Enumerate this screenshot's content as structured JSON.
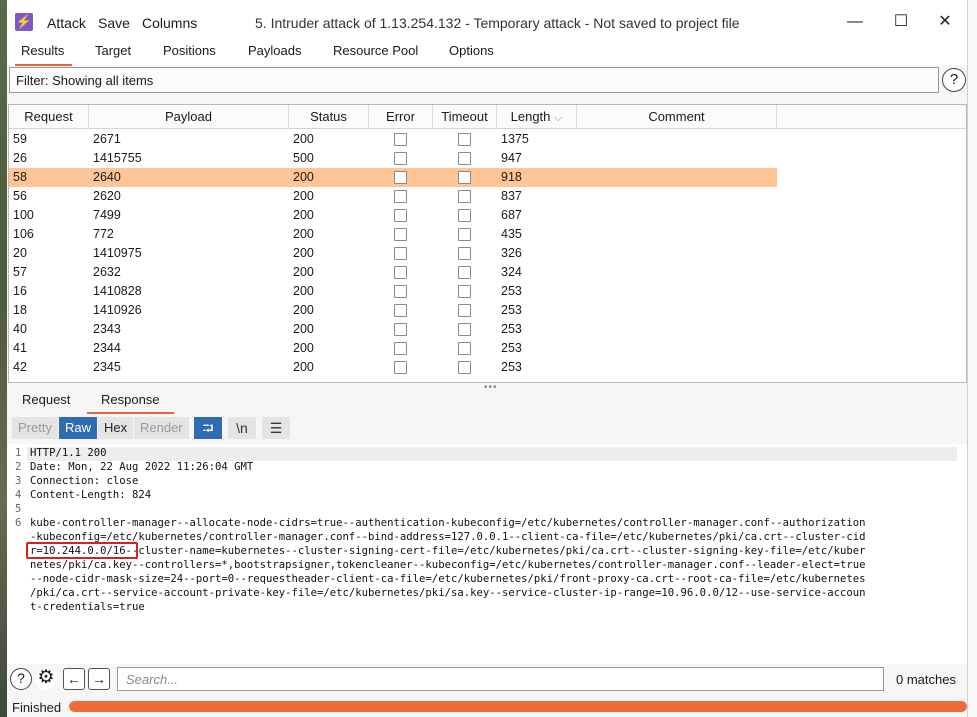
{
  "titlebar": {
    "menus": [
      "Attack",
      "Save",
      "Columns"
    ],
    "title": "5. Intruder attack of 1.13.254.132 - Temporary attack - Not saved to project file",
    "minimize": "—",
    "maximize": "☐",
    "close": "✕"
  },
  "main_tabs": [
    "Results",
    "Target",
    "Positions",
    "Payloads",
    "Resource Pool",
    "Options"
  ],
  "filter": {
    "text": "Filter: Showing all items",
    "help": "?"
  },
  "table": {
    "columns": [
      "Request",
      "Payload",
      "Status",
      "Error",
      "Timeout",
      "Length",
      "Comment"
    ],
    "sort_indicator": "⌵",
    "rows": [
      {
        "request": "59",
        "payload": "2671",
        "status": "200",
        "length": "1375",
        "selected": false
      },
      {
        "request": "26",
        "payload": "1415755",
        "status": "500",
        "length": "947",
        "selected": false
      },
      {
        "request": "58",
        "payload": "2640",
        "status": "200",
        "length": "918",
        "selected": true
      },
      {
        "request": "56",
        "payload": "2620",
        "status": "200",
        "length": "837",
        "selected": false
      },
      {
        "request": "100",
        "payload": "7499",
        "status": "200",
        "length": "687",
        "selected": false
      },
      {
        "request": "106",
        "payload": "772",
        "status": "200",
        "length": "435",
        "selected": false
      },
      {
        "request": "20",
        "payload": "1410975",
        "status": "200",
        "length": "326",
        "selected": false
      },
      {
        "request": "57",
        "payload": "2632",
        "status": "200",
        "length": "324",
        "selected": false
      },
      {
        "request": "16",
        "payload": "1410828",
        "status": "200",
        "length": "253",
        "selected": false
      },
      {
        "request": "18",
        "payload": "1410926",
        "status": "200",
        "length": "253",
        "selected": false
      },
      {
        "request": "40",
        "payload": "2343",
        "status": "200",
        "length": "253",
        "selected": false
      },
      {
        "request": "41",
        "payload": "2344",
        "status": "200",
        "length": "253",
        "selected": false
      },
      {
        "request": "42",
        "payload": "2345",
        "status": "200",
        "length": "253",
        "selected": false
      }
    ]
  },
  "sub_tabs": [
    "Request",
    "Response"
  ],
  "view_buttons": [
    "Pretty",
    "Raw",
    "Hex",
    "Render"
  ],
  "icon_buttons": [
    {
      "name": "wrap-lines-icon",
      "glyph": "⮒"
    },
    {
      "name": "newline-icon",
      "glyph": "\\n"
    },
    {
      "name": "menu-icon",
      "glyph": "☰"
    }
  ],
  "response": {
    "line_numbers": [
      "1",
      "2",
      "3",
      "4",
      "5",
      "6"
    ],
    "lines": [
      "HTTP/1.1 200",
      "Date: Mon, 22 Aug 2022 11:26:04 GMT",
      "Connection: close",
      "Content-Length: 824",
      "",
      "kube-controller-manager--allocate-node-cidrs=true--authentication-kubeconfig=/etc/kubernetes/controller-manager.conf--authorization",
      "-kubeconfig=/etc/kubernetes/controller-manager.conf--bind-address=127.0.0.1--client-ca-file=/etc/kubernetes/pki/ca.crt--cluster-cid",
      "r=10.244.0.0/16--cluster-name=kubernetes--cluster-signing-cert-file=/etc/kubernetes/pki/ca.crt--cluster-signing-key-file=/etc/kuber",
      "netes/pki/ca.key--controllers=*,bootstrapsigner,tokencleaner--kubeconfig=/etc/kubernetes/controller-manager.conf--leader-elect=true",
      "--node-cidr-mask-size=24--port=0--requestheader-client-ca-file=/etc/kubernetes/pki/front-proxy-ca.crt--root-ca-file=/etc/kubernetes",
      "/pki/ca.crt--service-account-private-key-file=/etc/kubernetes/pki/sa.key--service-cluster-ip-range=10.96.0.0/12--use-service-accoun",
      "t-credentials=true"
    ]
  },
  "search": {
    "placeholder": "Search...",
    "matches": "0 matches"
  },
  "status": {
    "text": "Finished",
    "progress": 1.0
  }
}
